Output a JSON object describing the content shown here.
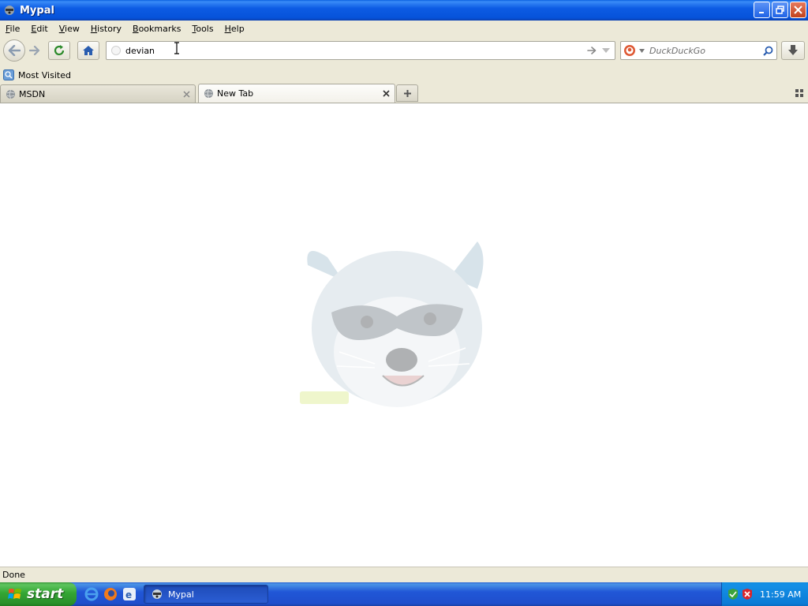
{
  "window": {
    "title": "Mypal"
  },
  "menu": {
    "items": [
      {
        "label": "File",
        "key": "F",
        "rest": "ile"
      },
      {
        "label": "Edit",
        "key": "E",
        "rest": "dit"
      },
      {
        "label": "View",
        "key": "V",
        "rest": "iew"
      },
      {
        "label": "History",
        "key": "H",
        "rest": "istory"
      },
      {
        "label": "Bookmarks",
        "key": "B",
        "rest": "ookmarks"
      },
      {
        "label": "Tools",
        "key": "T",
        "rest": "ools"
      },
      {
        "label": "Help",
        "key": "H",
        "rest": "elp"
      }
    ]
  },
  "navbar": {
    "url_value": "devian",
    "search_placeholder": "DuckDuckGo"
  },
  "bookmarks": {
    "most_visited": "Most Visited"
  },
  "tabs": [
    {
      "label": "MSDN",
      "selected": false
    },
    {
      "label": "New Tab",
      "selected": true
    }
  ],
  "status": {
    "text": "Done"
  },
  "taskbar": {
    "start_label": "start",
    "task_label": "Mypal",
    "clock": "11:59 AM"
  },
  "colors": {
    "titlebar": "#0652d9",
    "chrome": "#ece9d8",
    "taskbar": "#2157d7",
    "start": "#34a634"
  },
  "icons": {
    "app": "raccoon-icon",
    "back": "back-arrow-icon",
    "forward": "forward-arrow-icon",
    "reload": "reload-icon",
    "home": "home-icon",
    "download": "download-icon",
    "search": "magnifier-icon"
  }
}
